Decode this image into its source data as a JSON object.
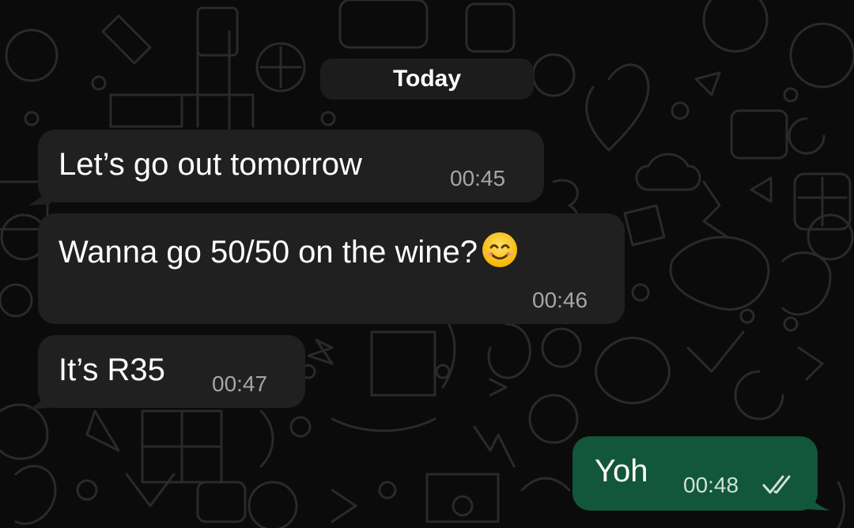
{
  "conversation": {
    "date_label": "Today",
    "messages": [
      {
        "direction": "incoming",
        "text": "Let’s go out tomorrow",
        "time": "00:45"
      },
      {
        "direction": "incoming",
        "text": "Wanna go 50/50 on the wine?",
        "emoji": "smiling-face-emoji",
        "time": "00:46"
      },
      {
        "direction": "incoming",
        "text": "It’s R35",
        "time": "00:47"
      },
      {
        "direction": "outgoing",
        "text": "Yoh",
        "time": "00:48",
        "status_icon": "double-check-icon"
      }
    ]
  },
  "colors": {
    "background": "#0b0b0b",
    "incoming_bubble": "#202020",
    "outgoing_bubble": "#12563c",
    "date_pill": "#1c1c1c",
    "timestamp": "#a6a6a6"
  }
}
